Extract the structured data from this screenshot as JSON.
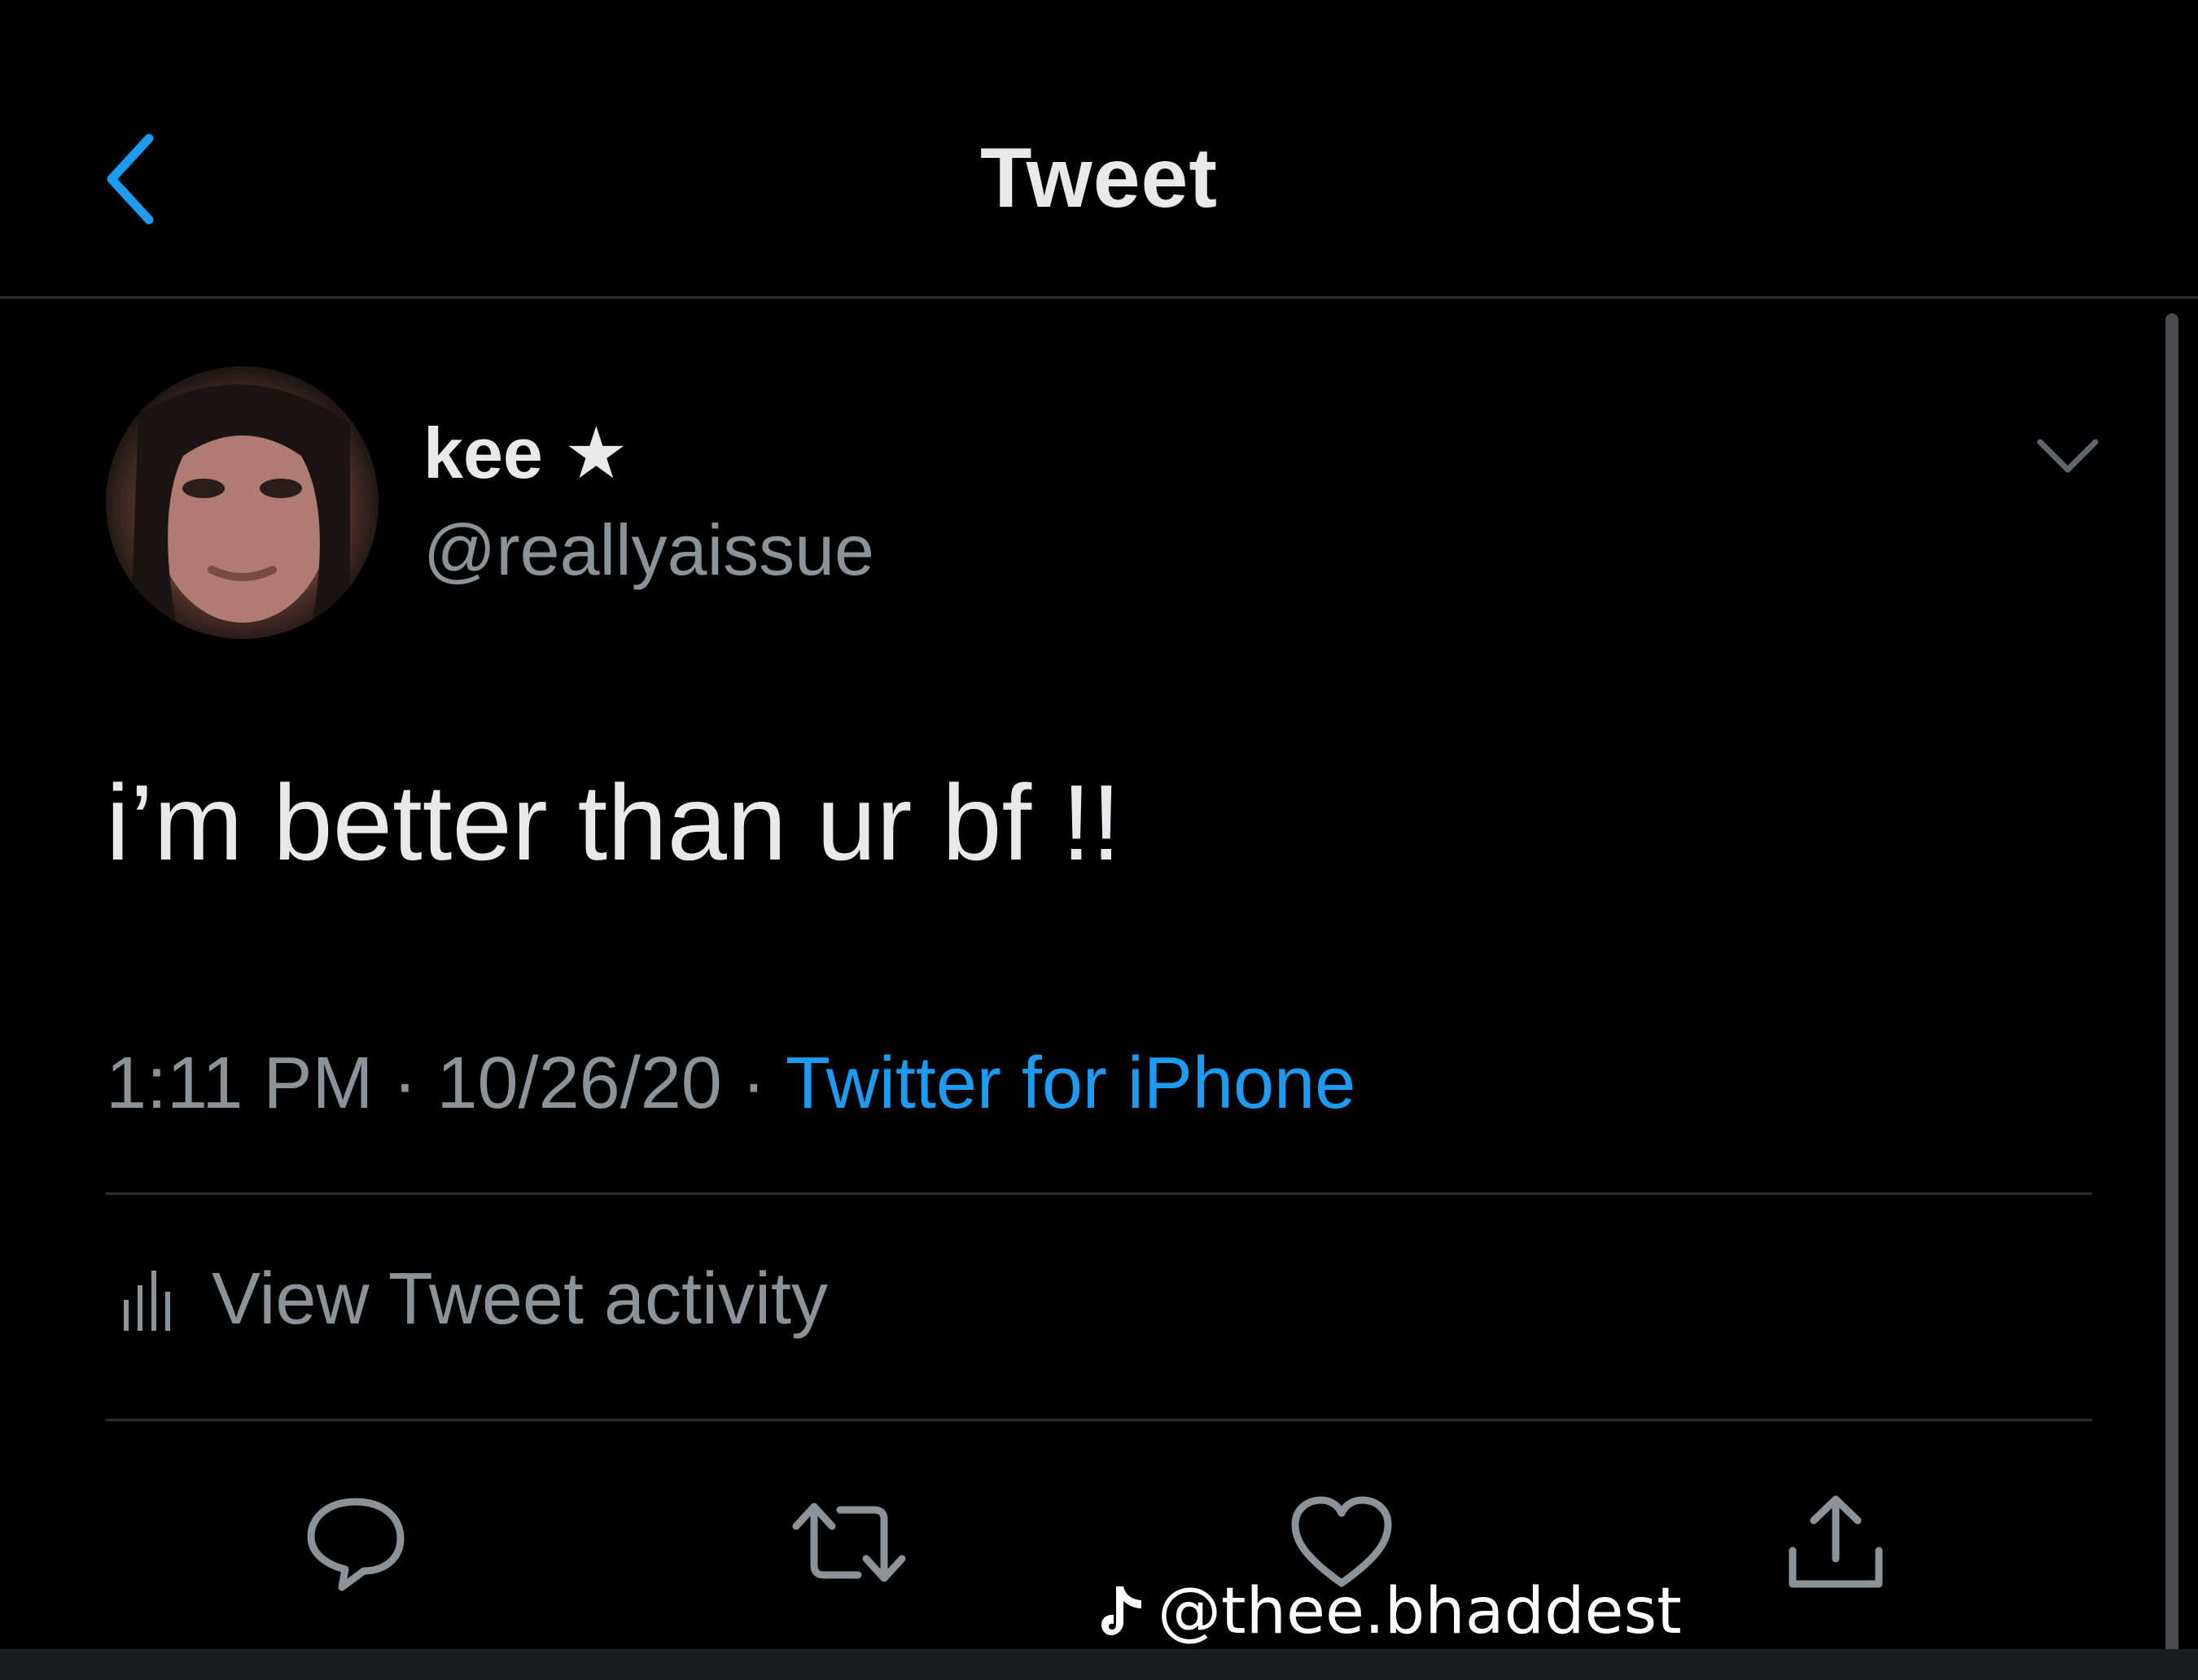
{
  "header": {
    "title": "Tweet",
    "back_icon": "chevron-left-icon"
  },
  "tweet": {
    "author": {
      "name": "kee",
      "name_emoji": "★",
      "handle": "@reallyaissue"
    },
    "text": "i’m better than ur bf !!",
    "time": "1:11 PM",
    "date": "10/26/20",
    "separator": "·",
    "source": "Twitter for iPhone",
    "activity_label": "View Tweet activity"
  },
  "actions": [
    {
      "icon": "reply-icon"
    },
    {
      "icon": "retweet-icon"
    },
    {
      "icon": "like-icon"
    },
    {
      "icon": "share-icon"
    }
  ],
  "watermark": {
    "text": "@thee.bhaddest"
  },
  "colors": {
    "background": "#000000",
    "text_primary": "#e7e9ea",
    "text_secondary": "#8b9298",
    "accent": "#1d9bf0",
    "divider": "#2a2d30"
  }
}
